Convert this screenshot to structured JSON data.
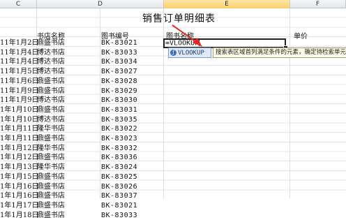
{
  "columns": {
    "c": "C",
    "d": "D",
    "e": "E",
    "f": "F"
  },
  "sheet": {
    "title": "销售订单明细表",
    "headers": {
      "store": "书店名称",
      "code": "图书编号",
      "book_name": "图书名称",
      "price": "单价"
    },
    "rows": [
      {
        "date": "11年1月2日",
        "store": "鼎盛书店",
        "code": "BK-83021"
      },
      {
        "date": "11年1月4日",
        "store": "博达书店",
        "code": "BK-83033"
      },
      {
        "date": "11年1月4日",
        "store": "博达书店",
        "code": "BK-83034"
      },
      {
        "date": "11年1月5日",
        "store": "博达书店",
        "code": "BK-83027"
      },
      {
        "date": "11年1月6日",
        "store": "鼎盛书店",
        "code": "BK-83028"
      },
      {
        "date": "11年1月9日",
        "store": "鼎盛书店",
        "code": "BK-83029"
      },
      {
        "date": "11年1月9日",
        "store": "博达书店",
        "code": "BK-83030"
      },
      {
        "date": "1年1月10日",
        "store": "鼎盛书店",
        "code": "BK-83031"
      },
      {
        "date": "1年1月10日",
        "store": "博达书店",
        "code": "BK-83035"
      },
      {
        "date": "1年1月11日",
        "store": "隆华书店",
        "code": "BK-83022"
      },
      {
        "date": "1年1月11日",
        "store": "鼎盛书店",
        "code": "BK-83023"
      },
      {
        "date": "1年1月12日",
        "store": "隆华书店",
        "code": "BK-83032"
      },
      {
        "date": "1年1月12日",
        "store": "鼎盛书店",
        "code": "BK-83036"
      },
      {
        "date": "1年1月13日",
        "store": "隆华书店",
        "code": "BK-83024"
      },
      {
        "date": "1年1月15日",
        "store": "鼎盛书店",
        "code": "BK-83025"
      },
      {
        "date": "1年1月16日",
        "store": "鼎盛书店",
        "code": "BK-83026"
      },
      {
        "date": "1年1月16日",
        "store": "鼎盛书店",
        "code": "BK-83037"
      },
      {
        "date": "1年1月17日",
        "store": "鼎盛书店",
        "code": "BK-83021"
      },
      {
        "date": "1年1月18日",
        "store": "鼎盛书店",
        "code": "BK-83033"
      }
    ]
  },
  "editing_cell": {
    "value": "=VLOOKUP"
  },
  "autocomplete": {
    "icon": "function-icon",
    "suggestion": "VLOOKUP",
    "tooltip": "搜索表区域首列满足条件的元素，确定待检索单元格在"
  },
  "annotation": {
    "arrow_color": "#e8281e"
  }
}
